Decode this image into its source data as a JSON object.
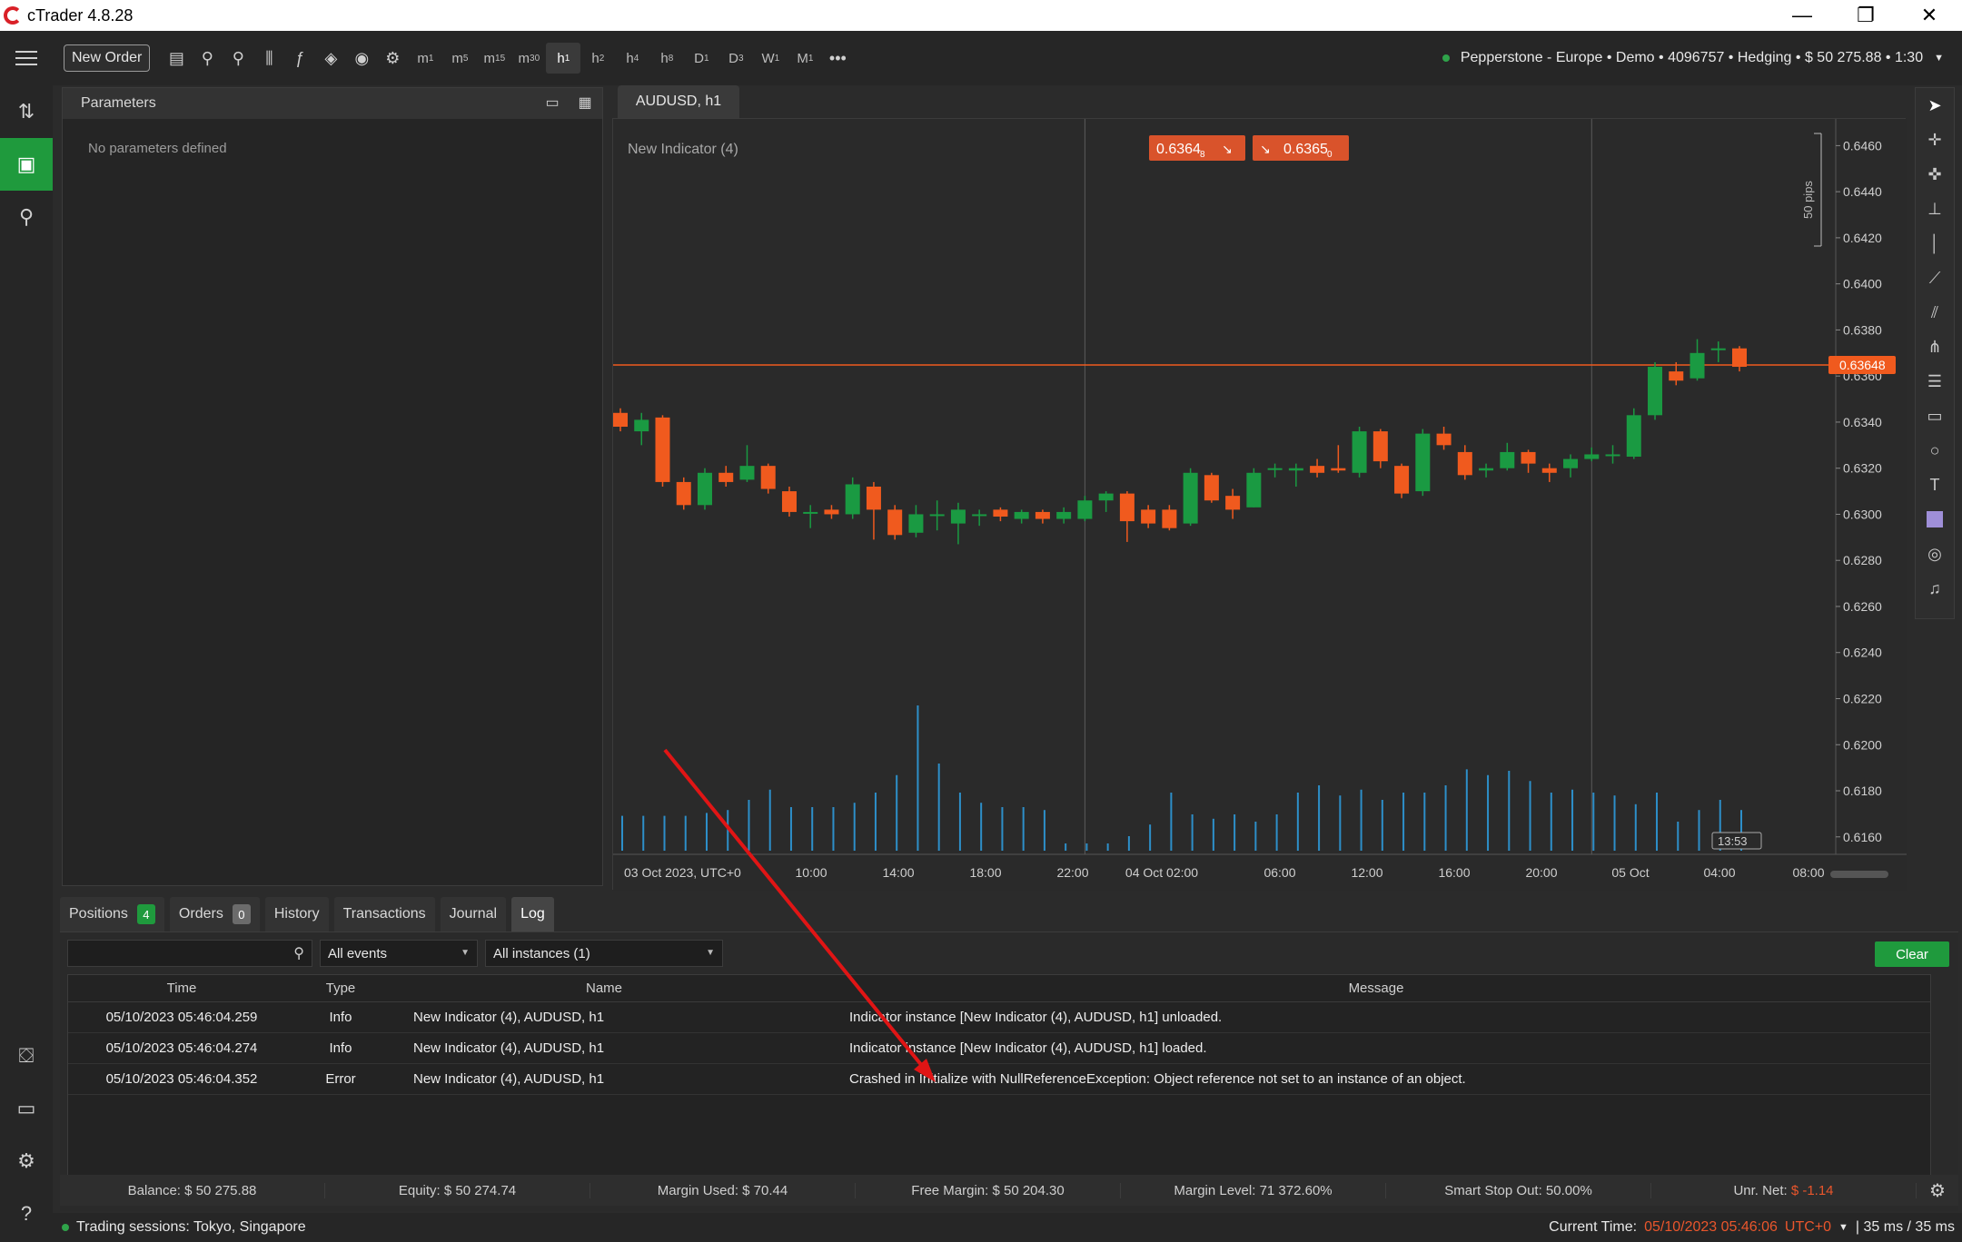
{
  "window": {
    "title": "cTrader 4.8.28",
    "minimize": "—",
    "restore": "❐",
    "close": "✕"
  },
  "toolbar": {
    "new_order": "New Order",
    "timeframes": [
      {
        "base": "m",
        "sub": "1"
      },
      {
        "base": "m",
        "sub": "5"
      },
      {
        "base": "m",
        "sub": "15"
      },
      {
        "base": "m",
        "sub": "30"
      },
      {
        "base": "h",
        "sub": "1"
      },
      {
        "base": "h",
        "sub": "2"
      },
      {
        "base": "h",
        "sub": "4"
      },
      {
        "base": "h",
        "sub": "8"
      },
      {
        "base": "D",
        "sub": "1"
      },
      {
        "base": "D",
        "sub": "3"
      },
      {
        "base": "W",
        "sub": "1"
      },
      {
        "base": "M",
        "sub": "1"
      }
    ],
    "more": "•••",
    "account": "Pepperstone - Europe • Demo • 4096757 • Hedging • $ 50 275.88 • 1:30"
  },
  "params": {
    "title": "Parameters",
    "empty": "No parameters defined"
  },
  "chart": {
    "tab": "AUDUSD, h1",
    "indicator_label": "New Indicator (4)",
    "sell_price": "0.6364",
    "sell_sup": "8",
    "buy_price": "0.6365",
    "buy_sup": "0",
    "current_price": "0.63648",
    "pips_label": "50 pips",
    "countdown": "13:53",
    "colors": {
      "up": "#1a9a42",
      "down": "#f05a1e",
      "volume": "#2d8fc9",
      "price_line": "#f05a1e"
    }
  },
  "chart_data": {
    "type": "candlestick",
    "title": "AUDUSD, h1",
    "y_ticks": [
      "0.6460",
      "0.6440",
      "0.6420",
      "0.6400",
      "0.6380",
      "0.6360",
      "0.6340",
      "0.6320",
      "0.6300",
      "0.6280",
      "0.6260",
      "0.6240",
      "0.6220",
      "0.6200",
      "0.6180",
      "0.6160"
    ],
    "x_ticks": [
      "03 Oct 2023, UTC+0",
      "10:00",
      "14:00",
      "18:00",
      "22:00",
      "04 Oct 02:00",
      "06:00",
      "12:00",
      "16:00",
      "20:00",
      "05 Oct",
      "04:00",
      "08:00"
    ],
    "ylim": [
      0.6154,
      0.647
    ],
    "candles": [
      [
        0.6344,
        0.6338,
        0.6346,
        0.6336
      ],
      [
        0.6336,
        0.6341,
        0.6344,
        0.633
      ],
      [
        0.6342,
        0.6314,
        0.6343,
        0.6312
      ],
      [
        0.6314,
        0.6304,
        0.6316,
        0.6302
      ],
      [
        0.6304,
        0.6318,
        0.632,
        0.6302
      ],
      [
        0.6318,
        0.6314,
        0.6321,
        0.6312
      ],
      [
        0.6315,
        0.6321,
        0.633,
        0.6314
      ],
      [
        0.6321,
        0.6311,
        0.6322,
        0.6309
      ],
      [
        0.631,
        0.6301,
        0.6312,
        0.6299
      ],
      [
        0.6301,
        0.6301,
        0.6304,
        0.6294
      ],
      [
        0.6302,
        0.63,
        0.6304,
        0.6298
      ],
      [
        0.63,
        0.6313,
        0.6316,
        0.6298
      ],
      [
        0.6312,
        0.6302,
        0.6314,
        0.6289
      ],
      [
        0.6302,
        0.6291,
        0.6304,
        0.6289
      ],
      [
        0.6292,
        0.63,
        0.6304,
        0.629
      ],
      [
        0.63,
        0.63,
        0.6306,
        0.6293
      ],
      [
        0.6296,
        0.6302,
        0.6305,
        0.6287
      ],
      [
        0.63,
        0.63,
        0.6302,
        0.6295
      ],
      [
        0.6302,
        0.6299,
        0.6303,
        0.6297
      ],
      [
        0.6298,
        0.6301,
        0.6302,
        0.6296
      ],
      [
        0.6301,
        0.6298,
        0.6302,
        0.6296
      ],
      [
        0.6298,
        0.6301,
        0.6303,
        0.6296
      ],
      [
        0.6298,
        0.6306,
        0.6308,
        0.6297
      ],
      [
        0.6306,
        0.6309,
        0.631,
        0.6301
      ],
      [
        0.6309,
        0.6297,
        0.631,
        0.6288
      ],
      [
        0.6302,
        0.6296,
        0.6304,
        0.6294
      ],
      [
        0.6302,
        0.6294,
        0.6304,
        0.6293
      ],
      [
        0.6296,
        0.6318,
        0.632,
        0.6295
      ],
      [
        0.6317,
        0.6306,
        0.6318,
        0.6305
      ],
      [
        0.6308,
        0.6302,
        0.6311,
        0.6298
      ],
      [
        0.6303,
        0.6318,
        0.632,
        0.6303
      ],
      [
        0.632,
        0.632,
        0.6322,
        0.6316
      ],
      [
        0.6319,
        0.632,
        0.6322,
        0.6312
      ],
      [
        0.6321,
        0.6318,
        0.6324,
        0.6316
      ],
      [
        0.632,
        0.6319,
        0.633,
        0.6318
      ],
      [
        0.6318,
        0.6336,
        0.6338,
        0.6316
      ],
      [
        0.6336,
        0.6323,
        0.6337,
        0.632
      ],
      [
        0.6321,
        0.6309,
        0.6322,
        0.6307
      ],
      [
        0.631,
        0.6335,
        0.6337,
        0.6308
      ],
      [
        0.6335,
        0.633,
        0.6338,
        0.6328
      ],
      [
        0.6327,
        0.6317,
        0.633,
        0.6315
      ],
      [
        0.6319,
        0.632,
        0.6322,
        0.6316
      ],
      [
        0.632,
        0.6327,
        0.6331,
        0.6319
      ],
      [
        0.6327,
        0.6322,
        0.6328,
        0.6318
      ],
      [
        0.632,
        0.6318,
        0.6322,
        0.6314
      ],
      [
        0.632,
        0.6324,
        0.6326,
        0.6316
      ],
      [
        0.6324,
        0.6326,
        0.6329,
        0.6323
      ],
      [
        0.6326,
        0.6326,
        0.633,
        0.6322
      ],
      [
        0.6325,
        0.6343,
        0.6346,
        0.6324
      ],
      [
        0.6343,
        0.6364,
        0.6366,
        0.6341
      ],
      [
        0.6362,
        0.6358,
        0.6366,
        0.6356
      ],
      [
        0.6359,
        0.637,
        0.6376,
        0.6358
      ],
      [
        0.6372,
        0.6372,
        0.6375,
        0.6366
      ],
      [
        0.6372,
        0.6364,
        0.6373,
        0.6362
      ]
    ],
    "volumes": [
      24,
      24,
      24,
      24,
      26,
      28,
      35,
      42,
      30,
      30,
      30,
      33,
      40,
      52,
      100,
      60,
      40,
      33,
      30,
      30,
      28,
      5,
      5,
      5,
      10,
      18,
      40,
      25,
      22,
      25,
      20,
      25,
      40,
      45,
      38,
      42,
      35,
      40,
      40,
      45,
      56,
      52,
      55,
      48,
      40,
      42,
      40,
      38,
      32,
      40,
      20,
      28,
      35,
      28,
      20,
      20,
      18
    ]
  },
  "bottom_tabs": [
    {
      "label": "Positions",
      "badge": "4",
      "badge_style": "green"
    },
    {
      "label": "Orders",
      "badge": "0",
      "badge_style": "gray"
    },
    {
      "label": "History"
    },
    {
      "label": "Transactions"
    },
    {
      "label": "Journal"
    },
    {
      "label": "Log"
    }
  ],
  "log": {
    "events_filter": "All events",
    "instances_filter": "All instances (1)",
    "clear": "Clear",
    "headers": {
      "time": "Time",
      "type": "Type",
      "name": "Name",
      "message": "Message"
    },
    "rows": [
      {
        "time": "05/10/2023 05:46:04.259",
        "type": "Info",
        "name": "New Indicator (4), AUDUSD, h1",
        "message": "Indicator instance [New Indicator (4), AUDUSD, h1] unloaded."
      },
      {
        "time": "05/10/2023 05:46:04.274",
        "type": "Info",
        "name": "New Indicator (4), AUDUSD, h1",
        "message": "Indicator instance [New Indicator (4), AUDUSD, h1] loaded."
      },
      {
        "time": "05/10/2023 05:46:04.352",
        "type": "Error",
        "name": "New Indicator (4), AUDUSD, h1",
        "message": "Crashed in Initialize with NullReferenceException: Object reference not set to an instance of an object."
      }
    ]
  },
  "status": {
    "balance": "Balance: $ 50 275.88",
    "equity": "Equity: $ 50 274.74",
    "margin_used": "Margin Used: $ 70.44",
    "free_margin": "Free Margin: $ 50 204.30",
    "margin_level": "Margin Level: 71 372.60%",
    "stop_out": "Smart Stop Out: 50.00%",
    "unr_label": "Unr. Net:",
    "unr_value": "$ -1.14"
  },
  "footer": {
    "sessions": "Trading sessions: Tokyo, Singapore",
    "current_time_label": "Current Time:",
    "current_time": "05/10/2023 05:46:06",
    "timezone": "UTC+0",
    "latency": "| 35 ms / 35 ms"
  }
}
